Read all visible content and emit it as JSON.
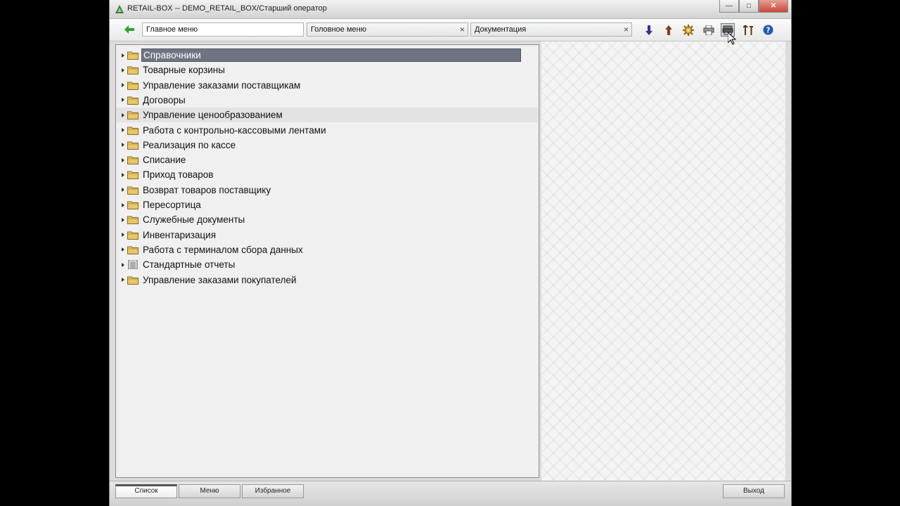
{
  "window": {
    "title": "RETAIL-BOX -- DEMO_RETAIL_BOX/Старший оператор",
    "controls": {
      "minimize": "—",
      "maximize": "□",
      "close": "✕"
    }
  },
  "toolbar": {
    "field_main": "Главное меню",
    "tab_head_menu": "Головное меню",
    "tab_documentation": "Документация",
    "tab_close_symbol": "×",
    "icons": [
      "back-arrow-icon",
      "arrow-down-icon",
      "arrow-up-icon",
      "gear-icon",
      "print-icon",
      "printer-stack-icon",
      "sort-icon",
      "help-icon"
    ]
  },
  "tree": {
    "items": [
      {
        "label": "Справочники",
        "icon": "folder-icon"
      },
      {
        "label": "Товарные корзины",
        "icon": "folder-icon"
      },
      {
        "label": "Управление заказами поставщикам",
        "icon": "folder-icon"
      },
      {
        "label": "Договоры",
        "icon": "folder-icon"
      },
      {
        "label": "Управление ценообразованием",
        "icon": "folder-icon"
      },
      {
        "label": "Работа с контрольно-кассовыми лентами",
        "icon": "folder-icon"
      },
      {
        "label": "Реализация по кассе",
        "icon": "folder-icon"
      },
      {
        "label": "Списание",
        "icon": "folder-icon"
      },
      {
        "label": "Приход товаров",
        "icon": "folder-icon"
      },
      {
        "label": "Возврат товаров поставщику",
        "icon": "folder-icon"
      },
      {
        "label": "Пересортица",
        "icon": "folder-icon"
      },
      {
        "label": "Служебные документы",
        "icon": "folder-icon"
      },
      {
        "label": "Инвентаризация",
        "icon": "folder-icon"
      },
      {
        "label": "Работа с терминалом сбора данных",
        "icon": "folder-icon"
      },
      {
        "label": "Стандартные отчеты",
        "icon": "report-icon"
      },
      {
        "label": "Управление заказами покупателей",
        "icon": "folder-icon"
      }
    ],
    "selected_index": 0,
    "hover_index": 4
  },
  "bottom_bar": {
    "tab_list": "Список",
    "tab_menu": "Меню",
    "tab_favorites": "Избранное",
    "exit": "Выход"
  },
  "colors": {
    "selection": "#6f7482",
    "folder": "#e8c66a",
    "accent_green": "#2aa52a"
  }
}
